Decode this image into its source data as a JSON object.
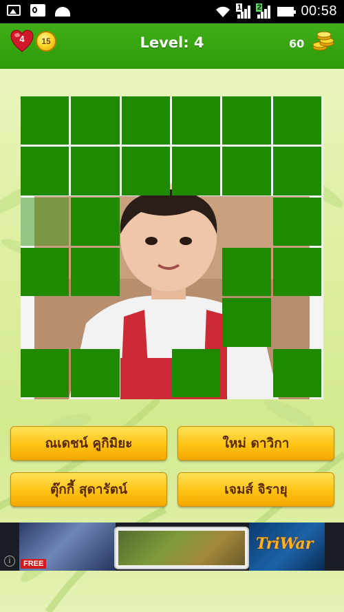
{
  "status_bar": {
    "time": "00:58",
    "icons": [
      "image-icon",
      "outlook-icon",
      "android-icon",
      "wifi-icon",
      "signal-1-icon",
      "signal-2-icon",
      "battery-icon"
    ],
    "sim1_label": "1",
    "sim2_label": "2"
  },
  "header": {
    "lives": "4",
    "hints": "15",
    "level_label": "Level: 4",
    "coins": "60",
    "colors": {
      "bar": "#2f9a0b",
      "heart": "#d0182a",
      "coin": "#ffd92a"
    }
  },
  "puzzle": {
    "grid_cols": 6,
    "grid_rows": 6,
    "tile_color": "#1f8a00",
    "hidden_tiles": [
      [
        1,
        1,
        1,
        1,
        1,
        1
      ],
      [
        1,
        1,
        1,
        1,
        1,
        1
      ],
      [
        2,
        1,
        0,
        0,
        0,
        1
      ],
      [
        1,
        1,
        0,
        0,
        1,
        1
      ],
      [
        0,
        0,
        0,
        0,
        1,
        0
      ],
      [
        1,
        1,
        0,
        1,
        0,
        1
      ]
    ],
    "image": "child-portrait"
  },
  "answers": [
    {
      "label": "ณเดชน์ คูกิมิยะ"
    },
    {
      "label": "ใหม่ ดาวิกา"
    },
    {
      "label": "ตุ๊กกี้ สุดารัตน์"
    },
    {
      "label": "เจมส์ จิรายุ"
    }
  ],
  "ad": {
    "badge": "FREE",
    "brand": "TriWar",
    "info_icon": "info-icon"
  }
}
